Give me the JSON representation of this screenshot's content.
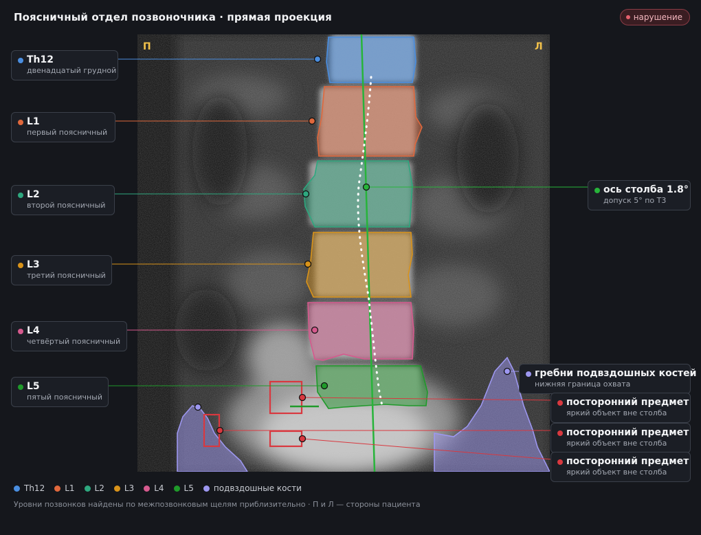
{
  "header": {
    "title": "Поясничный отдел позвоночника · прямая проекция",
    "status_badge": "нарушение"
  },
  "image": {
    "side_right_patient": "П",
    "side_left_patient": "Л"
  },
  "colors": {
    "th12": "#4a8ee0",
    "l1": "#e0683c",
    "l2": "#2ea87f",
    "l3": "#d9931a",
    "l4": "#d65a8e",
    "l5": "#1f9a2a",
    "iliac": "#9d97f0",
    "foreign": "#d9383f",
    "axis": "#27b43a"
  },
  "vertebra_labels": [
    {
      "id": "th12",
      "name": "Th12",
      "desc": "двенадцатый грудной"
    },
    {
      "id": "l1",
      "name": "L1",
      "desc": "первый поясничный"
    },
    {
      "id": "l2",
      "name": "L2",
      "desc": "второй поясничный"
    },
    {
      "id": "l3",
      "name": "L3",
      "desc": "третий поясничный"
    },
    {
      "id": "l4",
      "name": "L4",
      "desc": "четвёртый поясничный"
    },
    {
      "id": "l5",
      "name": "L5",
      "desc": "пятый поясничный"
    }
  ],
  "axis_label": {
    "name": "ось столба 1.8°",
    "desc": "допуск 5° по Т3"
  },
  "iliac_label": {
    "name": "гребни подвздошных костей",
    "desc": "нижняя граница охвата"
  },
  "foreign_labels": [
    {
      "name": "посторонний предмет",
      "desc": "яркий объект вне столба"
    },
    {
      "name": "посторонний предмет",
      "desc": "яркий объект вне столба"
    },
    {
      "name": "посторонний предмет",
      "desc": "яркий объект вне столба"
    }
  ],
  "legend": [
    "Th12",
    "L1",
    "L2",
    "L3",
    "L4",
    "L5",
    "подвздошные кости"
  ],
  "footer_note": "Уровни позвонков найдены по межпозвонковым щелям приблизительно · П и Л — стороны пациента"
}
